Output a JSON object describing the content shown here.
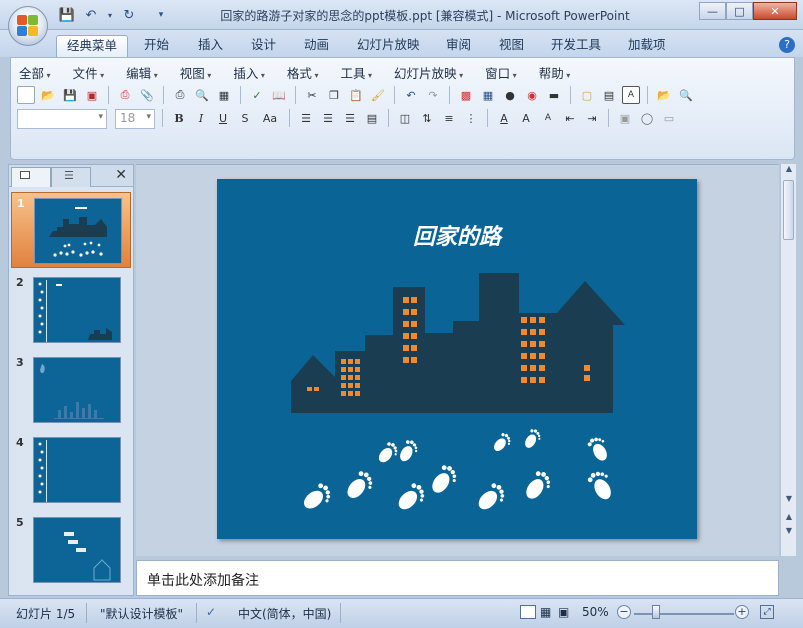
{
  "window": {
    "title": "回家的路游子对家的思念的ppt模板.ppt [兼容模式] - Microsoft PowerPoint"
  },
  "tabs": [
    {
      "label": "经典菜单"
    },
    {
      "label": "开始"
    },
    {
      "label": "插入"
    },
    {
      "label": "设计"
    },
    {
      "label": "动画"
    },
    {
      "label": "幻灯片放映"
    },
    {
      "label": "审阅"
    },
    {
      "label": "视图"
    },
    {
      "label": "开发工具"
    },
    {
      "label": "加载项"
    }
  ],
  "menu": [
    {
      "label": "全部"
    },
    {
      "label": "文件"
    },
    {
      "label": "编辑"
    },
    {
      "label": "视图"
    },
    {
      "label": "插入"
    },
    {
      "label": "格式"
    },
    {
      "label": "工具"
    },
    {
      "label": "幻灯片放映"
    },
    {
      "label": "窗口"
    },
    {
      "label": "帮助"
    }
  ],
  "format": {
    "font_name": "",
    "font_size": "18"
  },
  "slides": [
    {
      "num": "1"
    },
    {
      "num": "2"
    },
    {
      "num": "3"
    },
    {
      "num": "4"
    },
    {
      "num": "5"
    }
  ],
  "slide": {
    "title": "回家的路"
  },
  "notes": {
    "placeholder": "单击此处添加备注"
  },
  "status": {
    "slide_info": "幻灯片 1/5",
    "template": "\"默认设计模板\"",
    "language": "中文(简体，中国)",
    "zoom": "50%"
  },
  "colors": {
    "slide_bg": "#0b6496",
    "building": "#1b3d52",
    "window": "#f08a2c",
    "selected_thumb": "#e0823e"
  }
}
